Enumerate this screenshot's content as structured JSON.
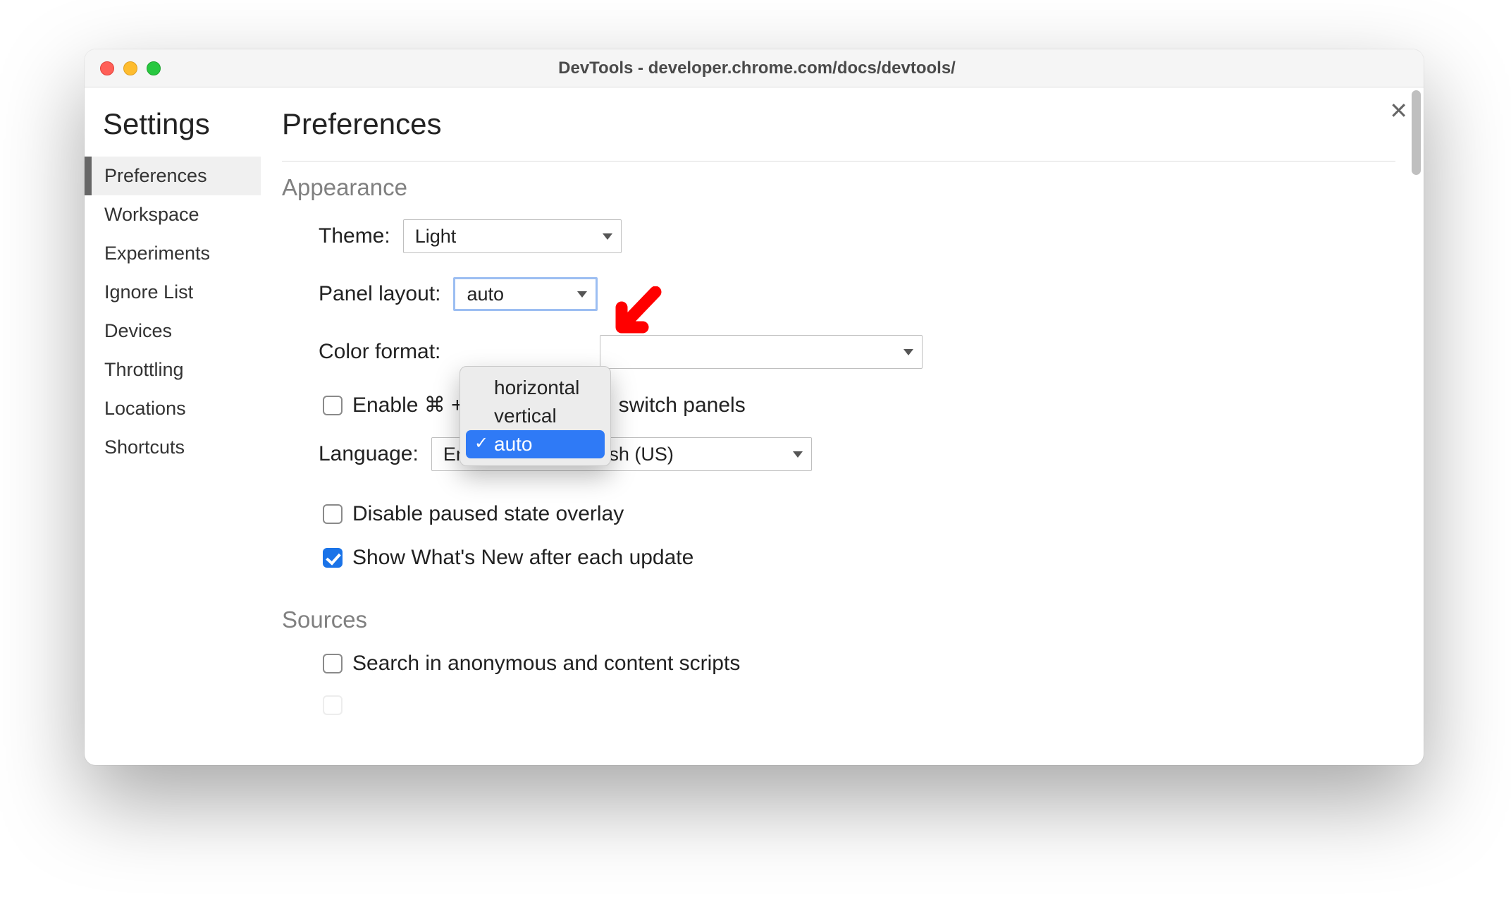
{
  "window": {
    "title": "DevTools - developer.chrome.com/docs/devtools/"
  },
  "settings_heading": "Settings",
  "sidebar": {
    "selected_index": 0,
    "items": [
      "Preferences",
      "Workspace",
      "Experiments",
      "Ignore List",
      "Devices",
      "Throttling",
      "Locations",
      "Shortcuts"
    ]
  },
  "page_title": "Preferences",
  "appearance": {
    "heading": "Appearance",
    "theme": {
      "label": "Theme:",
      "value": "Light"
    },
    "panel_layout": {
      "label": "Panel layout:",
      "value": "auto",
      "options": [
        "horizontal",
        "vertical",
        "auto"
      ],
      "selected_index": 2
    },
    "color_format": {
      "label": "Color format:"
    },
    "enable_shortcut": {
      "prefix": "Enable ⌘ + ",
      "suffix": " switch panels",
      "checked": false
    },
    "language": {
      "label": "Language:",
      "value": "English (US) - English (US)"
    },
    "disable_paused": {
      "label": "Disable paused state overlay",
      "checked": false
    },
    "show_whats_new": {
      "label": "Show What's New after each update",
      "checked": true
    }
  },
  "sources": {
    "heading": "Sources",
    "search_anon": {
      "label": "Search in anonymous and content scripts",
      "checked": false
    }
  },
  "annotation": {
    "color": "#ff0000"
  }
}
